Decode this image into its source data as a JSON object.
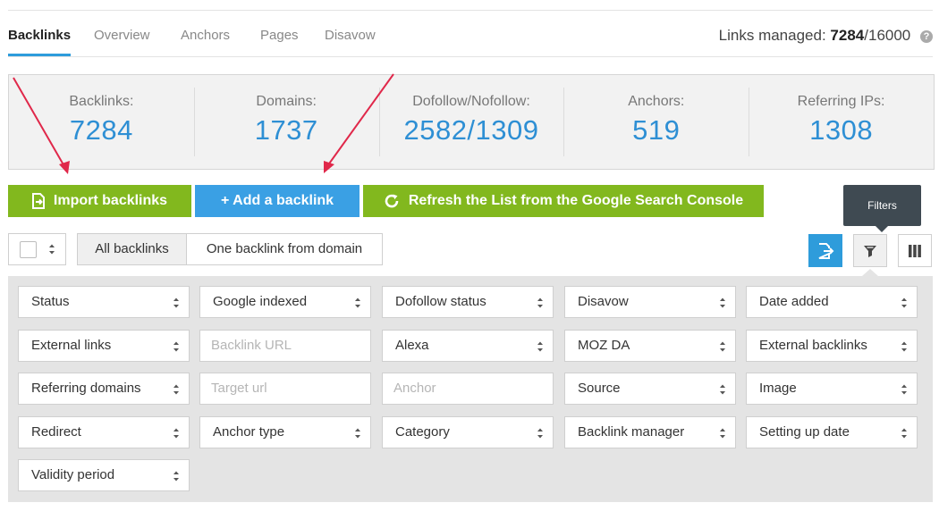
{
  "tabs": [
    {
      "label": "Backlinks",
      "active": true
    },
    {
      "label": "Overview",
      "active": false
    },
    {
      "label": "Anchors",
      "active": false
    },
    {
      "label": "Pages",
      "active": false
    },
    {
      "label": "Disavow",
      "active": false
    }
  ],
  "links_managed": {
    "label": "Links managed:",
    "used": "7284",
    "separator": "/",
    "total": "16000",
    "help": "?"
  },
  "stats": [
    {
      "label": "Backlinks:",
      "value": "7284"
    },
    {
      "label": "Domains:",
      "value": "1737"
    },
    {
      "label": "Dofollow/Nofollow:",
      "value": "2582/1309"
    },
    {
      "label": "Anchors:",
      "value": "519"
    },
    {
      "label": "Referring IPs:",
      "value": "1308"
    }
  ],
  "actions": {
    "import": "Import backlinks",
    "add": "+ Add a backlink",
    "refresh": "Refresh the List from the Google Search Console"
  },
  "tooltip": "Filters",
  "view_toggle": {
    "all": "All backlinks",
    "one": "One backlink from domain"
  },
  "filters": {
    "row1": [
      "Status",
      "Google indexed",
      "Dofollow status",
      "Disavow",
      "Date added"
    ],
    "row2": {
      "external_links": "External links",
      "backlink_url_placeholder": "Backlink URL",
      "alexa": "Alexa",
      "moz_da": "MOZ DA",
      "external_backlinks": "External backlinks"
    },
    "row3": {
      "referring_domains": "Referring domains",
      "target_url_placeholder": "Target url",
      "anchor_placeholder": "Anchor",
      "source": "Source",
      "image": "Image"
    },
    "row4": [
      "Redirect",
      "Anchor type",
      "Category",
      "Backlink manager",
      "Setting up date"
    ],
    "row5": [
      "Validity period"
    ]
  },
  "colors": {
    "accent_blue": "#2e9cdb",
    "value_blue": "#2e8fd4",
    "green": "#82b81e",
    "tooltip": "#3f4a52"
  }
}
